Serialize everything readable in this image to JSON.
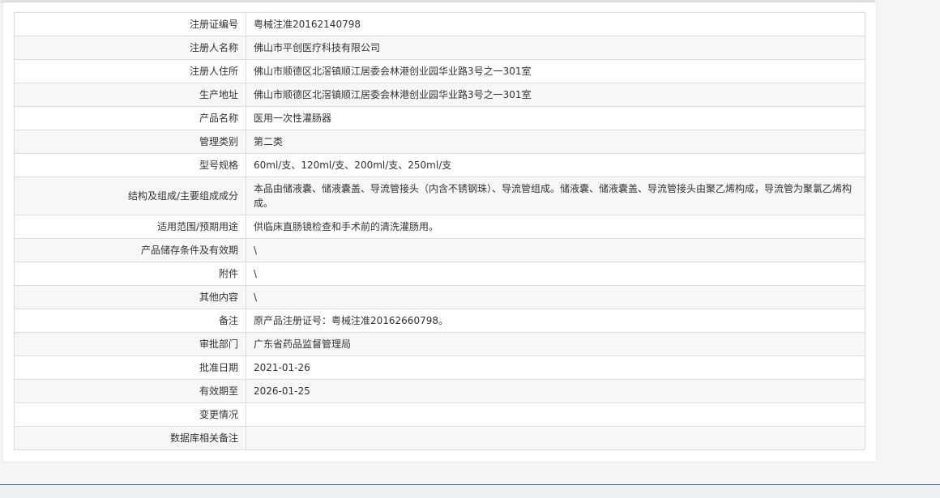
{
  "rows": [
    {
      "label": "注册证编号",
      "value": "粤械注准20162140798"
    },
    {
      "label": "注册人名称",
      "value": "佛山市平创医疗科技有限公司"
    },
    {
      "label": "注册人住所",
      "value": "佛山市顺德区北滘镇顺江居委会林港创业园华业路3号之一301室"
    },
    {
      "label": "生产地址",
      "value": "佛山市顺德区北滘镇顺江居委会林港创业园华业路3号之一301室"
    },
    {
      "label": "产品名称",
      "value": "医用一次性灌肠器"
    },
    {
      "label": "管理类别",
      "value": "第二类"
    },
    {
      "label": "型号规格",
      "value": "60ml/支、120ml/支、200ml/支、250ml/支"
    },
    {
      "label": "结构及组成/主要组成成分",
      "value": "本品由储液囊、储液囊盖、导流管接头（内含不锈钢珠）、导流管组成。储液囊、储液囊盖、导流管接头由聚乙烯构成，导流管为聚氯乙烯构成。"
    },
    {
      "label": "适用范围/预期用途",
      "value": "供临床直肠镜检查和手术前的清洗灌肠用。"
    },
    {
      "label": "产品储存条件及有效期",
      "value": "\\"
    },
    {
      "label": "附件",
      "value": "\\"
    },
    {
      "label": "其他内容",
      "value": "\\"
    },
    {
      "label": "备注",
      "value": "原产品注册证号：粤械注准20162660798。"
    },
    {
      "label": "审批部门",
      "value": "广东省药品监督管理局"
    },
    {
      "label": "批准日期",
      "value": "2021-01-26"
    },
    {
      "label": "有效期至",
      "value": "2026-01-25"
    },
    {
      "label": "变更情况",
      "value": ""
    },
    {
      "label": "数据库相关备注",
      "value": ""
    }
  ]
}
